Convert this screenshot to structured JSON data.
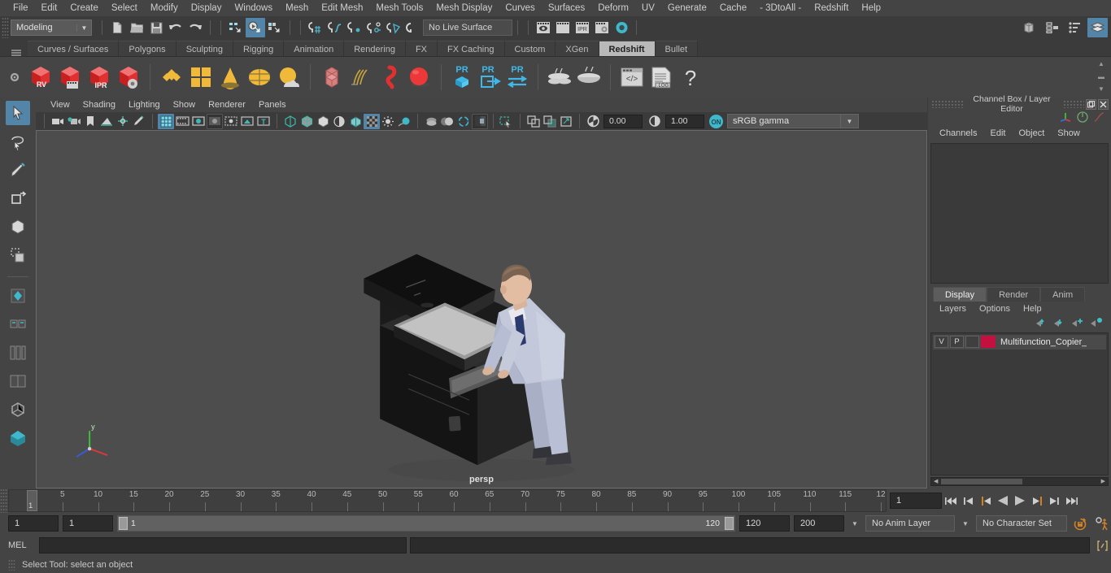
{
  "menubar": {
    "items": [
      "File",
      "Edit",
      "Create",
      "Select",
      "Modify",
      "Display",
      "Windows",
      "Mesh",
      "Edit Mesh",
      "Mesh Tools",
      "Mesh Display",
      "Curves",
      "Surfaces",
      "Deform",
      "UV",
      "Generate",
      "Cache",
      "- 3DtoAll -",
      "Redshift",
      "Help"
    ]
  },
  "statusline": {
    "mode": "Modeling",
    "live_surface": "No Live Surface",
    "icons": [
      "new-scene-icon",
      "open-scene-icon",
      "save-scene-icon",
      "undo-icon",
      "redo-icon",
      "select-by-hierarchy-icon",
      "select-by-object-icon",
      "select-by-component-icon",
      "snap-to-grid-icon",
      "snap-to-curve-icon",
      "snap-to-point-icon",
      "snap-to-projected-center-icon",
      "snap-to-view-plane-icon",
      "make-live-icon",
      "render-view-icon",
      "render-region-icon",
      "ipr-render-icon",
      "render-settings-icon",
      "hypershade-icon"
    ],
    "right_icons": [
      "show-hide-modeling-panel-icon",
      "show-hide-attribute-editor-icon",
      "show-hide-tool-settings-icon",
      "show-hide-channel-box-icon"
    ]
  },
  "shelf": {
    "tabs": [
      "Curves / Surfaces",
      "Polygons",
      "Sculpting",
      "Rigging",
      "Animation",
      "Rendering",
      "FX",
      "FX Caching",
      "Custom",
      "XGen",
      "Redshift",
      "Bullet"
    ],
    "active_tab": "Redshift",
    "icons": [
      "redshift-rv-icon",
      "redshift-render-sequence-icon",
      "redshift-ipr-icon",
      "redshift-render-settings-icon",
      "redshift-material-icon",
      "redshift-light-dome-icon",
      "redshift-light-area-icon",
      "redshift-light-ies-icon",
      "redshift-environment-icon",
      "redshift-proxy-icon",
      "redshift-hair-icon",
      "redshift-volume-icon",
      "redshift-sphere-icon",
      "redshift-pr-object-icon",
      "redshift-pr-export-icon",
      "redshift-pr-toggle-icon",
      "redshift-bake-icon",
      "redshift-bakeset-icon",
      "redshift-script-icon",
      "redshift-log-icon",
      "redshift-help-icon"
    ],
    "labels": {
      "rv": "RV",
      "ipr": "IPR",
      "pr": "PR",
      "log": ".LOG",
      "help": "?"
    }
  },
  "toolbox": {
    "tools": [
      "select-tool-icon",
      "lasso-select-tool-icon",
      "paint-select-tool-icon",
      "move-tool-icon",
      "rotate-tool-icon",
      "scale-tool-icon",
      "last-tool-icon",
      "snap-transform-icon",
      "toggle-visibility-icon",
      "layout-single-icon",
      "layout-two-pane-icon",
      "layout-hypergraph-icon",
      "layout-outliner-icon",
      "layout-persp-icon"
    ]
  },
  "viewport": {
    "menu": [
      "View",
      "Shading",
      "Lighting",
      "Show",
      "Renderer",
      "Panels"
    ],
    "camera_label": "persp",
    "toolbar_icons": [
      "select-camera-icon",
      "camera-attributes-icon",
      "bookmark-icon",
      "image-plane-icon",
      "two-d-pan-zoom-icon",
      "grease-pencil-icon",
      "grid-toggle-icon",
      "film-gate-icon",
      "resolution-gate-icon",
      "gate-mask-icon",
      "field-chart-icon",
      "safe-action-icon",
      "safe-title-icon",
      "wireframe-icon",
      "smooth-shade-all-icon",
      "shaded-textured-icon",
      "use-default-lighting-icon",
      "shadows-icon",
      "occlusion-icon",
      "motion-blur-icon",
      "multisample-icon",
      "isolate-select-icon",
      "xray-icon",
      "xray-joints-icon",
      "xray-active-components-icon",
      "exposure-icon",
      "gamma-icon"
    ],
    "exposure": "0.00",
    "gamma": "1.00",
    "color_toggle": "ON",
    "color_space": "sRGB gamma"
  },
  "channelbox": {
    "title": "Channel Box / Layer Editor",
    "window_buttons": [
      "undock-icon",
      "close-icon"
    ],
    "header_icons": [
      "axis-icon",
      "anim-layer-icon",
      "graph-icon"
    ],
    "menu": [
      "Channels",
      "Edit",
      "Object",
      "Show"
    ]
  },
  "layereditor": {
    "tabs": [
      "Display",
      "Render",
      "Anim"
    ],
    "active_tab": "Display",
    "menu": [
      "Layers",
      "Options",
      "Help"
    ],
    "buttons": [
      "move-layer-up-icon",
      "move-layer-down-icon",
      "new-layer-icon",
      "new-layer-from-selected-icon"
    ],
    "layers": [
      {
        "visible": "V",
        "playback": "P",
        "state": "",
        "color": "#c41040",
        "name": "Multifunction_Copier_"
      }
    ]
  },
  "timeline": {
    "ticks": [
      5,
      10,
      15,
      20,
      25,
      30,
      35,
      40,
      45,
      50,
      55,
      60,
      65,
      70,
      75,
      80,
      85,
      90,
      95,
      100,
      105,
      110,
      115,
      12
    ],
    "current_frame_marker": "1",
    "current_frame_field": "1",
    "playback_buttons": [
      "go-to-start-icon",
      "step-back-keyframe-icon",
      "step-back-frame-icon",
      "play-backwards-icon",
      "play-forwards-icon",
      "step-forward-frame-icon",
      "step-forward-keyframe-icon",
      "go-to-end-icon"
    ]
  },
  "rangeslider": {
    "start_field": "1",
    "anim_start_field": "1",
    "range_start": "1",
    "range_end": "120",
    "anim_end_field": "120",
    "end_field": "200",
    "anim_layer": "No Anim Layer",
    "character_set": "No Character Set",
    "right_icons": [
      "auto-keyframe-icon",
      "animation-preferences-icon"
    ]
  },
  "command": {
    "label": "MEL",
    "input_value": "",
    "output_value": "",
    "expand_icon": "expand-script-editor-icon"
  },
  "statusbar": {
    "message": "Select Tool: select an object"
  },
  "colors": {
    "accent": "#5285a8",
    "shelf_highlight": "#b9b9b9",
    "layer_swatch": "#c41040",
    "orange": "#d07820"
  }
}
